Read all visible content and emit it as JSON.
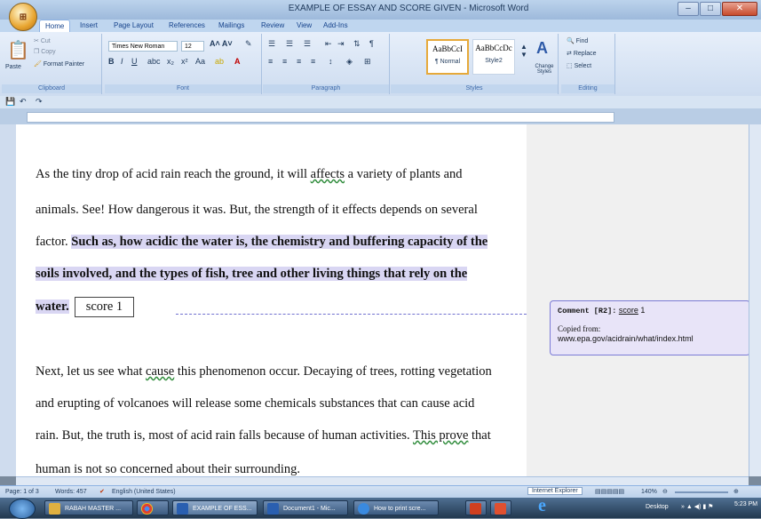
{
  "window": {
    "title": "EXAMPLE OF ESSAY AND SCORE GIVEN - Microsoft Word",
    "minimize": "–",
    "maximize": "□",
    "close": "✕"
  },
  "tabs": [
    "Home",
    "Insert",
    "Page Layout",
    "References",
    "Mailings",
    "Review",
    "View",
    "Add-Ins"
  ],
  "ribbon": {
    "clipboard": {
      "label": "Clipboard",
      "paste": "Paste",
      "cut": "Cut",
      "copy": "Copy",
      "format_painter": "Format Painter"
    },
    "font": {
      "label": "Font",
      "font_name": "Times New Roman",
      "font_size": "12"
    },
    "paragraph": {
      "label": "Paragraph"
    },
    "styles": {
      "label": "Styles",
      "normal_preview": "AaBbCcI",
      "normal_name": "¶ Normal",
      "style2_preview": "AaBbCcDc",
      "style2_name": "Style2",
      "change_styles": "Change Styles"
    },
    "editing": {
      "label": "Editing",
      "find": "Find",
      "replace": "Replace",
      "select": "Select"
    }
  },
  "document": {
    "lines": [
      {
        "parts": [
          {
            "t": "As the tiny drop of acid rain reach the ground, it will "
          },
          {
            "t": "affects",
            "style": "wavy"
          },
          {
            "t": " a variety of plants and"
          }
        ]
      },
      {
        "parts": [
          {
            "t": "animals. See! How dangerous it was. But, the strength of it effects depends on several"
          }
        ]
      },
      {
        "parts": [
          {
            "t": "factor. "
          },
          {
            "t": "Such as, how acidic the water is, the chemistry and buffering capacity of the",
            "style": "hl"
          }
        ]
      },
      {
        "parts": [
          {
            "t": "soils involved, and the types of fish, tree and other living things that rely on the",
            "style": "hl"
          }
        ]
      },
      {
        "parts": [
          {
            "t": "water.",
            "style": "hl"
          }
        ]
      },
      {
        "parts": [
          {
            "t": "Next, let us see what "
          },
          {
            "t": "cause",
            "style": "wavy"
          },
          {
            "t": " this phenomenon occur. Decaying of trees, rotting vegetation"
          }
        ]
      },
      {
        "parts": [
          {
            "t": "and erupting of volcanoes will release some chemicals substances that can cause acid"
          }
        ]
      },
      {
        "parts": [
          {
            "t": "rain. But, the truth is, most of acid rain falls because of human activities. "
          },
          {
            "t": "This prove",
            "style": "wavy"
          },
          {
            "t": " that"
          }
        ]
      },
      {
        "parts": [
          {
            "t": "human is not so concerned about their surrounding."
          }
        ]
      }
    ],
    "score_box": "score 1"
  },
  "comment": {
    "head": "Comment [R2]:",
    "score_word": "score",
    "score_value": "1",
    "body_line1": "Copied from:",
    "body_line2": "www.epa.gov/acidrain/what/index.html"
  },
  "status": {
    "page": "Page: 1 of 3",
    "words": "Words: 457",
    "language": "English (United States)",
    "zoom": "140%"
  },
  "taskbar": {
    "items": [
      "RABAH MASTER ...",
      "EXAMPLE OF ESS...",
      "Document1 - Mic...",
      "How to print scre..."
    ],
    "internet_explorer": "Internet Explorer",
    "desktop": "Desktop",
    "time": "5:23 PM"
  },
  "colors": {
    "highlight": "#d9d6f3",
    "comment_bg": "#e8e4f8",
    "comment_border": "#7b7bd6"
  }
}
